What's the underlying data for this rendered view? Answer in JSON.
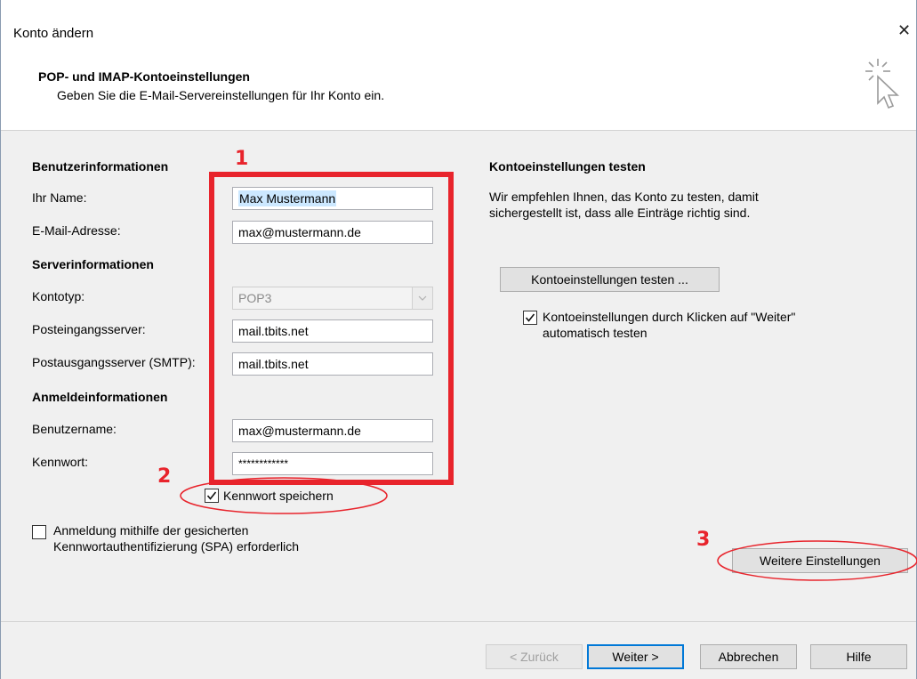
{
  "window": {
    "title": "Konto ändern",
    "close_glyph": "✕"
  },
  "header": {
    "title": "POP- und IMAP-Kontoeinstellungen",
    "subtitle": "Geben Sie die E-Mail-Servereinstellungen für Ihr Konto ein.",
    "icon": "sparkle-cursor-icon"
  },
  "user_info": {
    "heading": "Benutzerinformationen",
    "name_label": "Ihr Name:",
    "name_value": "Max Mustermann",
    "email_label": "E-Mail-Adresse:",
    "email_value": "max@mustermann.de"
  },
  "server_info": {
    "heading": "Serverinformationen",
    "account_type_label": "Kontotyp:",
    "account_type_value": "POP3",
    "incoming_label": "Posteingangsserver:",
    "incoming_value": "mail.tbits.net",
    "outgoing_label": "Postausgangsserver (SMTP):",
    "outgoing_value": "mail.tbits.net"
  },
  "login_info": {
    "heading": "Anmeldeinformationen",
    "username_label": "Benutzername:",
    "username_value": "max@mustermann.de",
    "password_label": "Kennwort:",
    "password_value": "************",
    "save_password_label": "Kennwort speichern",
    "save_password_checked": true,
    "spa_label_line1": "Anmeldung mithilfe der gesicherten",
    "spa_label_line2": "Kennwortauthentifizierung (SPA) erforderlich",
    "spa_checked": false
  },
  "test_settings": {
    "heading": "Kontoeinstellungen testen",
    "description_line1": "Wir empfehlen Ihnen, das Konto zu testen, damit",
    "description_line2": "sichergestellt ist, dass alle Einträge richtig sind.",
    "test_button": "Kontoeinstellungen testen ...",
    "auto_test_line1": "Kontoeinstellungen durch Klicken auf \"Weiter\"",
    "auto_test_line2": "automatisch testen",
    "auto_test_checked": true
  },
  "more_settings_button": "Weitere Einstellungen",
  "footer": {
    "back": "< Zurück",
    "next": "Weiter >",
    "cancel": "Abbrechen",
    "help": "Hilfe"
  },
  "annotations": {
    "n1": "1",
    "n2": "2",
    "n3": "3",
    "color": "#e8242c"
  }
}
